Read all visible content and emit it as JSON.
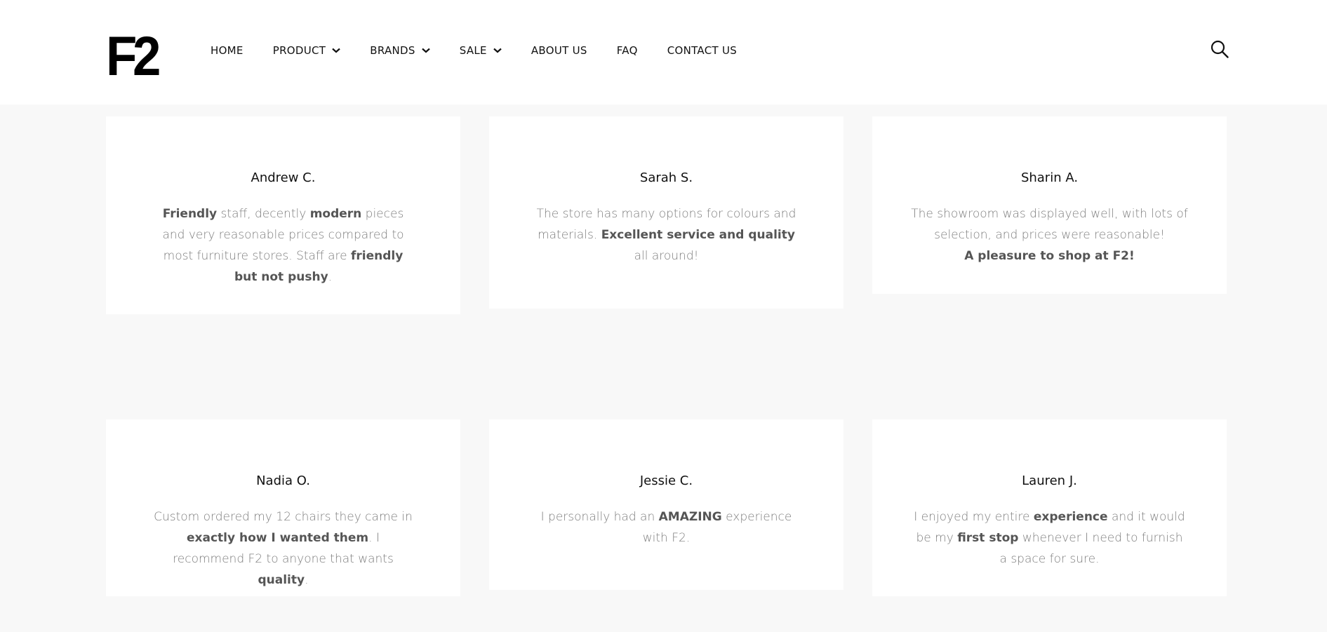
{
  "header": {
    "logo": "F2",
    "nav": [
      {
        "label": "HOME",
        "dropdown": false
      },
      {
        "label": "PRODUCT",
        "dropdown": true
      },
      {
        "label": "BRANDS",
        "dropdown": true
      },
      {
        "label": "SALE",
        "dropdown": true
      },
      {
        "label": "ABOUT US",
        "dropdown": false
      },
      {
        "label": "FAQ",
        "dropdown": false
      },
      {
        "label": "CONTACT US",
        "dropdown": false
      }
    ],
    "search_icon": "search-icon"
  },
  "testimonials": [
    {
      "name": "Andrew C.",
      "segments": [
        {
          "text": "Friendly",
          "bold": true
        },
        {
          "text": " staff, decently ",
          "bold": false
        },
        {
          "text": "modern",
          "bold": true
        },
        {
          "text": " pieces and very reasonable prices compared to most furniture stores. Staff are ",
          "bold": false
        },
        {
          "text": "friendly but not pushy",
          "bold": true
        },
        {
          "text": ".",
          "bold": false
        }
      ]
    },
    {
      "name": "Sarah S.",
      "segments": [
        {
          "text": "The store has many options for colours and materials. ",
          "bold": false
        },
        {
          "text": "Excellent service and quality",
          "bold": true
        },
        {
          "text": " all around!",
          "bold": false
        }
      ]
    },
    {
      "name": "Sharin A.",
      "segments": [
        {
          "text": "The showroom was displayed well, with lots of selection, and prices were reasonable!",
          "bold": false
        },
        {
          "text": "A pleasure to shop at F2!",
          "bold": true,
          "newline": true
        }
      ]
    },
    {
      "name": "Nadia O.",
      "segments": [
        {
          "text": "Custom ordered my 12 chairs they came in ",
          "bold": false
        },
        {
          "text": "exactly how I wanted them",
          "bold": true
        },
        {
          "text": ". I recommend F2 to anyone that wants ",
          "bold": false
        },
        {
          "text": "quality",
          "bold": true
        },
        {
          "text": ".",
          "bold": false
        }
      ]
    },
    {
      "name": "Jessie C.",
      "segments": [
        {
          "text": "I personally had an ",
          "bold": false
        },
        {
          "text": "AMAZING",
          "bold": true
        },
        {
          "text": " experience with F2.",
          "bold": false
        }
      ]
    },
    {
      "name": "Lauren J.",
      "segments": [
        {
          "text": "I enjoyed my entire ",
          "bold": false
        },
        {
          "text": "experience",
          "bold": true
        },
        {
          "text": " and it would be my ",
          "bold": false
        },
        {
          "text": "first stop",
          "bold": true
        },
        {
          "text": " whenever I need to furnish a space for sure.",
          "bold": false
        }
      ]
    }
  ]
}
